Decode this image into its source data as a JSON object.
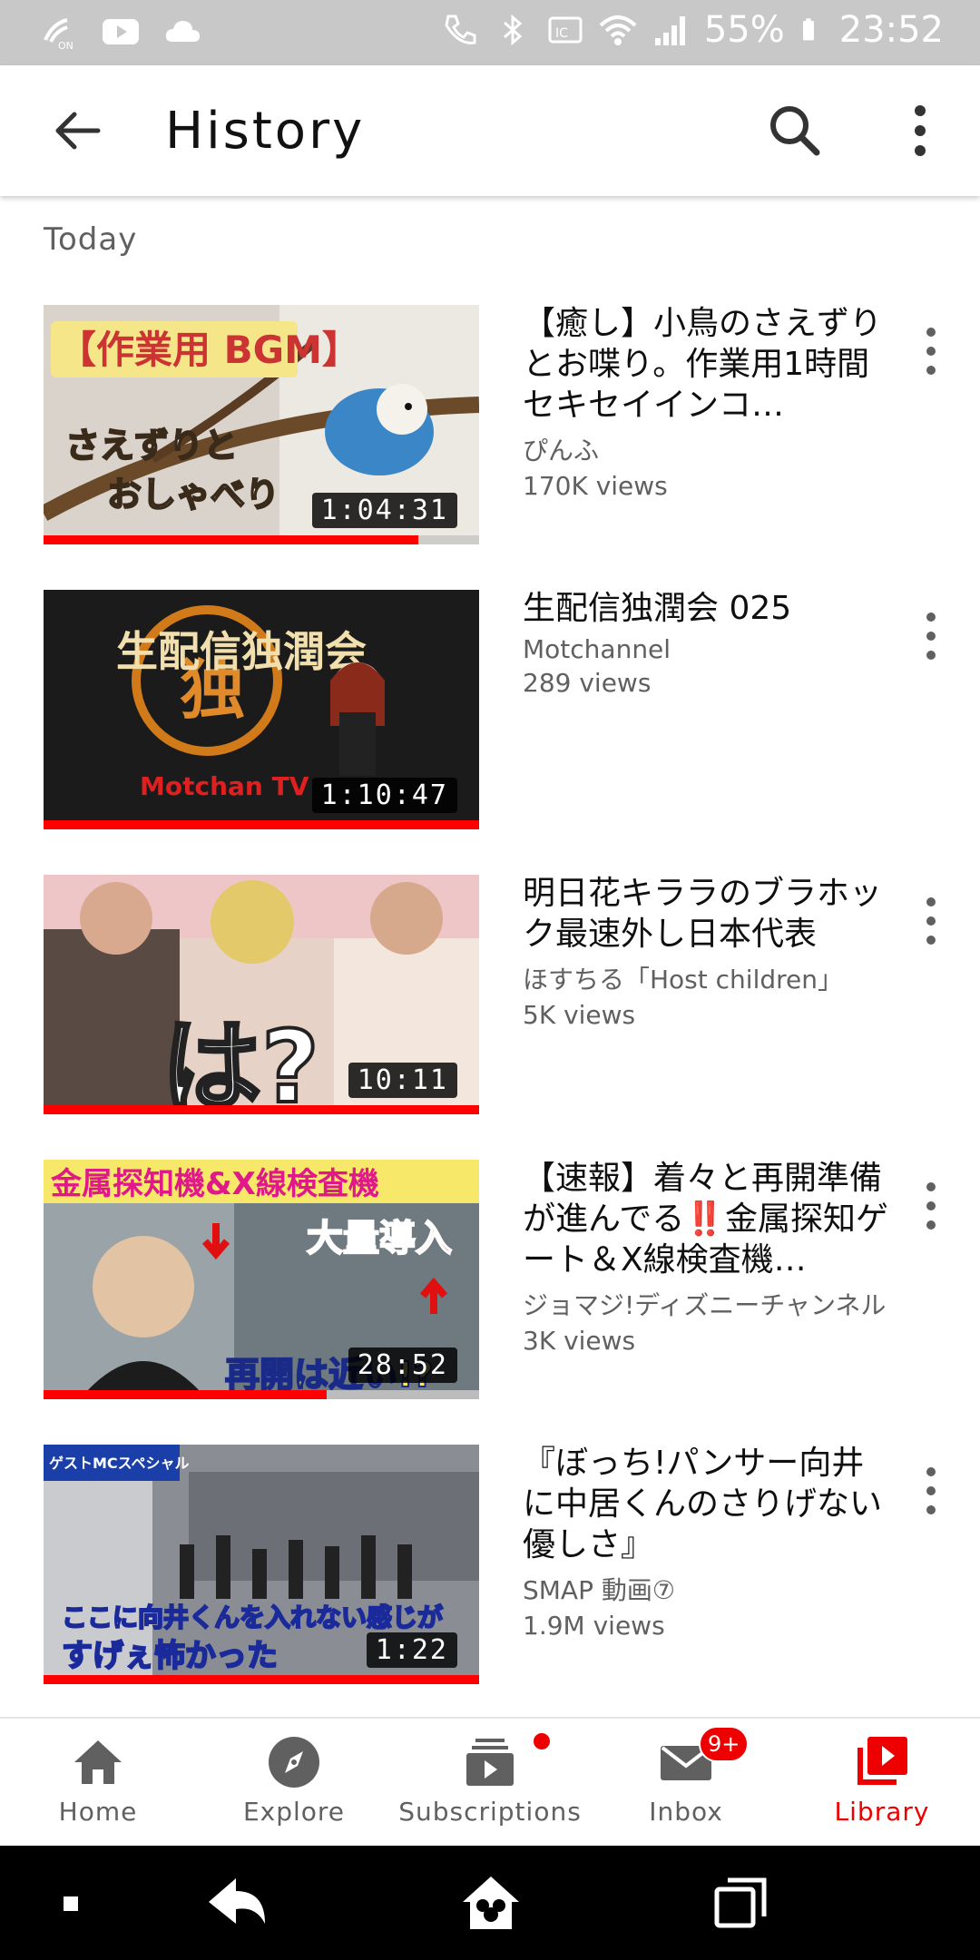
{
  "status_bar": {
    "battery": "55%",
    "time": "23:52",
    "icons": [
      "nfc-icon",
      "youtube-icon",
      "cloud-icon",
      "wifi-calling-icon",
      "bluetooth-icon",
      "ic-card-icon",
      "wifi-icon",
      "signal-icon",
      "battery-icon"
    ]
  },
  "app_bar": {
    "title": "History",
    "back_icon": "arrow-back-icon",
    "search_icon": "search-icon",
    "more_icon": "more-vert-icon"
  },
  "section": {
    "label": "Today"
  },
  "videos": [
    {
      "title": "【癒し】小鳥のさえずりとお喋り。作業用1時間　セキセイインコ…",
      "channel": "ぴんふ",
      "views": "170K views",
      "duration": "1:04:31",
      "watched_fraction": 0.86,
      "thumb_text": [
        "【作業用 BGM】",
        "さえずりと",
        "おしゃべり"
      ]
    },
    {
      "title": "生配信独潤会 025",
      "channel": "Motchannel",
      "views": "289 views",
      "duration": "1:10:47",
      "watched_fraction": 1.0,
      "thumb_text": [
        "生配信独潤会",
        "独",
        "Motchan TV"
      ]
    },
    {
      "title": "明日花キララのブラホック最速外し日本代表",
      "channel": "ほすちる「Host children」",
      "views": "5K views",
      "duration": "10:11",
      "watched_fraction": 1.0,
      "thumb_text": [
        "は?"
      ]
    },
    {
      "title": "【速報】着々と再開準備が進んでる‼️金属探知ゲート＆X線検査機…",
      "channel": "ジョマジ!ディズニーチャンネル",
      "views": "3K views",
      "duration": "28:52",
      "watched_fraction": 0.65,
      "thumb_text": [
        "金属探知機&X線検査機",
        "大量導入",
        "再開は近い!?"
      ]
    },
    {
      "title": "『ぼっち!パンサー向井に中居くんのさりげない優しさ』",
      "channel": "SMAP 動画⑦",
      "views": "1.9M views",
      "duration": "1:22",
      "watched_fraction": 1.0,
      "thumb_text": [
        "ゲストMCスペシャル",
        "ここに向井くんを入れない感じが",
        "すげぇ怖かった"
      ]
    }
  ],
  "bottom_nav": [
    {
      "label": "Home",
      "icon": "home-icon",
      "active": false
    },
    {
      "label": "Explore",
      "icon": "compass-icon",
      "active": false
    },
    {
      "label": "Subscriptions",
      "icon": "subscriptions-icon",
      "active": false,
      "badge_dot": true
    },
    {
      "label": "Inbox",
      "icon": "mail-icon",
      "active": false,
      "badge": "9+"
    },
    {
      "label": "Library",
      "icon": "library-icon",
      "active": true
    }
  ],
  "system_nav": {
    "icons": [
      "recents-small-icon",
      "back-icon",
      "home-mouse-icon",
      "overview-icon"
    ]
  },
  "colors": {
    "accent": "#ff0000",
    "text_secondary": "#606060",
    "status_bar": "#c8c8c8"
  }
}
